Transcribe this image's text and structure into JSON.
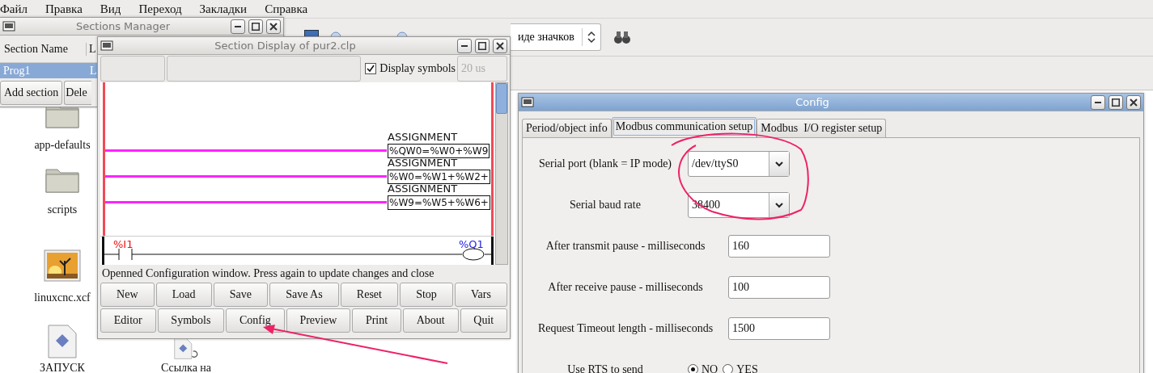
{
  "menu": [
    "Файл",
    "Правка",
    "Вид",
    "Переход",
    "Закладки",
    "Справка"
  ],
  "toolbar": {
    "view_mode": "иде значков"
  },
  "desktop_icons": [
    {
      "label": "app-defaults",
      "kind": "folder"
    },
    {
      "label": "scripts",
      "kind": "folder"
    },
    {
      "label": "linuxcnc.xcf",
      "kind": "image"
    },
    {
      "label": "ЗАПУСК",
      "kind": "document"
    },
    {
      "label": "Ссылка на",
      "kind": "link"
    }
  ],
  "sections_manager": {
    "title": "Sections Manager",
    "columns": [
      "Section Name",
      "L"
    ],
    "rows": [
      {
        "cells": [
          "Prog1",
          "L"
        ],
        "selected": true
      }
    ],
    "buttons": [
      "Add section",
      "Dele"
    ]
  },
  "section_display": {
    "title": "Section Display of pur2.clp",
    "display_symbols": {
      "label": "Display symbols",
      "checked": true
    },
    "scan_time": "20 us",
    "assignments": [
      {
        "heading": "ASSIGNMENT",
        "expression": "%QW0=%W0+%W9"
      },
      {
        "heading": "ASSIGNMENT",
        "expression": "%W0=%W1+%W2+"
      },
      {
        "heading": "ASSIGNMENT",
        "expression": "%W9=%W5+%W6+"
      }
    ],
    "contact": "%I1",
    "coil": "%Q1",
    "status": "Openned Configuration window. Press again to update changes and close",
    "button_rows": [
      [
        "New",
        "Load",
        "Save",
        "Save As",
        "Reset",
        "Stop",
        "Vars"
      ],
      [
        "Editor",
        "Symbols",
        "Config",
        "Preview",
        "Print",
        "About",
        "Quit"
      ]
    ]
  },
  "config": {
    "title": "Config",
    "tabs": [
      {
        "label": "Period/object info",
        "selected": false
      },
      {
        "label": "Modbus communication setup",
        "selected": true
      },
      {
        "label": "Modbus  I/O register setup",
        "selected": false
      }
    ],
    "fields": [
      {
        "kind": "select",
        "label": "Serial port (blank = IP mode)",
        "value": "/dev/ttyS0"
      },
      {
        "kind": "select",
        "label": "Serial baud rate",
        "value": "38400"
      },
      {
        "kind": "text",
        "label": "After transmit pause - milliseconds",
        "value": "160"
      },
      {
        "kind": "text",
        "label": "After receive pause - milliseconds",
        "value": "100"
      },
      {
        "kind": "text",
        "label": "Request Timeout length - milliseconds",
        "value": "1500"
      },
      {
        "kind": "radio",
        "label": "Use RTS to send",
        "options": [
          {
            "label": "NO",
            "selected": true
          },
          {
            "label": "YES",
            "selected": false
          }
        ]
      }
    ]
  }
}
